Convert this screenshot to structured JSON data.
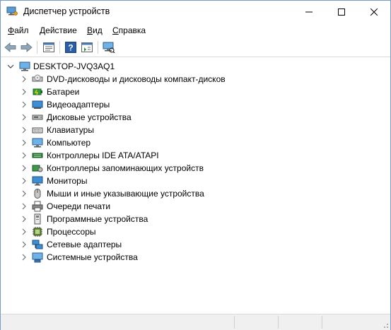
{
  "window": {
    "title": "Диспетчер устройств"
  },
  "menu": [
    {
      "label": "Файл"
    },
    {
      "label": "Действие"
    },
    {
      "label": "Вид"
    },
    {
      "label": "Справка"
    }
  ],
  "toolbar": {
    "buttons": [
      "back-icon",
      "forward-icon",
      "properties-icon",
      "help-icon",
      "update-driver-icon",
      "scan-hardware-icon"
    ]
  },
  "tree": {
    "root": "DESKTOP-JVQ3AQ1",
    "items": [
      {
        "label": "DVD-дисководы и дисководы компакт-дисков",
        "icon": "dvd-drive-icon"
      },
      {
        "label": "Батареи",
        "icon": "battery-icon"
      },
      {
        "label": "Видеоадаптеры",
        "icon": "display-adapter-icon"
      },
      {
        "label": "Дисковые устройства",
        "icon": "disk-drive-icon"
      },
      {
        "label": "Клавиатуры",
        "icon": "keyboard-icon"
      },
      {
        "label": "Компьютер",
        "icon": "computer-icon"
      },
      {
        "label": "Контроллеры IDE ATA/ATAPI",
        "icon": "ide-controller-icon"
      },
      {
        "label": "Контроллеры запоминающих устройств",
        "icon": "storage-controller-icon"
      },
      {
        "label": "Мониторы",
        "icon": "monitor-icon"
      },
      {
        "label": "Мыши и иные указывающие устройства",
        "icon": "mouse-icon"
      },
      {
        "label": "Очереди печати",
        "icon": "printer-icon"
      },
      {
        "label": "Программные устройства",
        "icon": "software-device-icon"
      },
      {
        "label": "Процессоры",
        "icon": "processor-icon"
      },
      {
        "label": "Сетевые адаптеры",
        "icon": "network-adapter-icon"
      },
      {
        "label": "Системные устройства",
        "icon": "system-device-icon"
      }
    ]
  },
  "colors": {
    "accent": "#1e6fbd",
    "border": "#7a9ac8",
    "statusbar": "#f0f0f0"
  }
}
